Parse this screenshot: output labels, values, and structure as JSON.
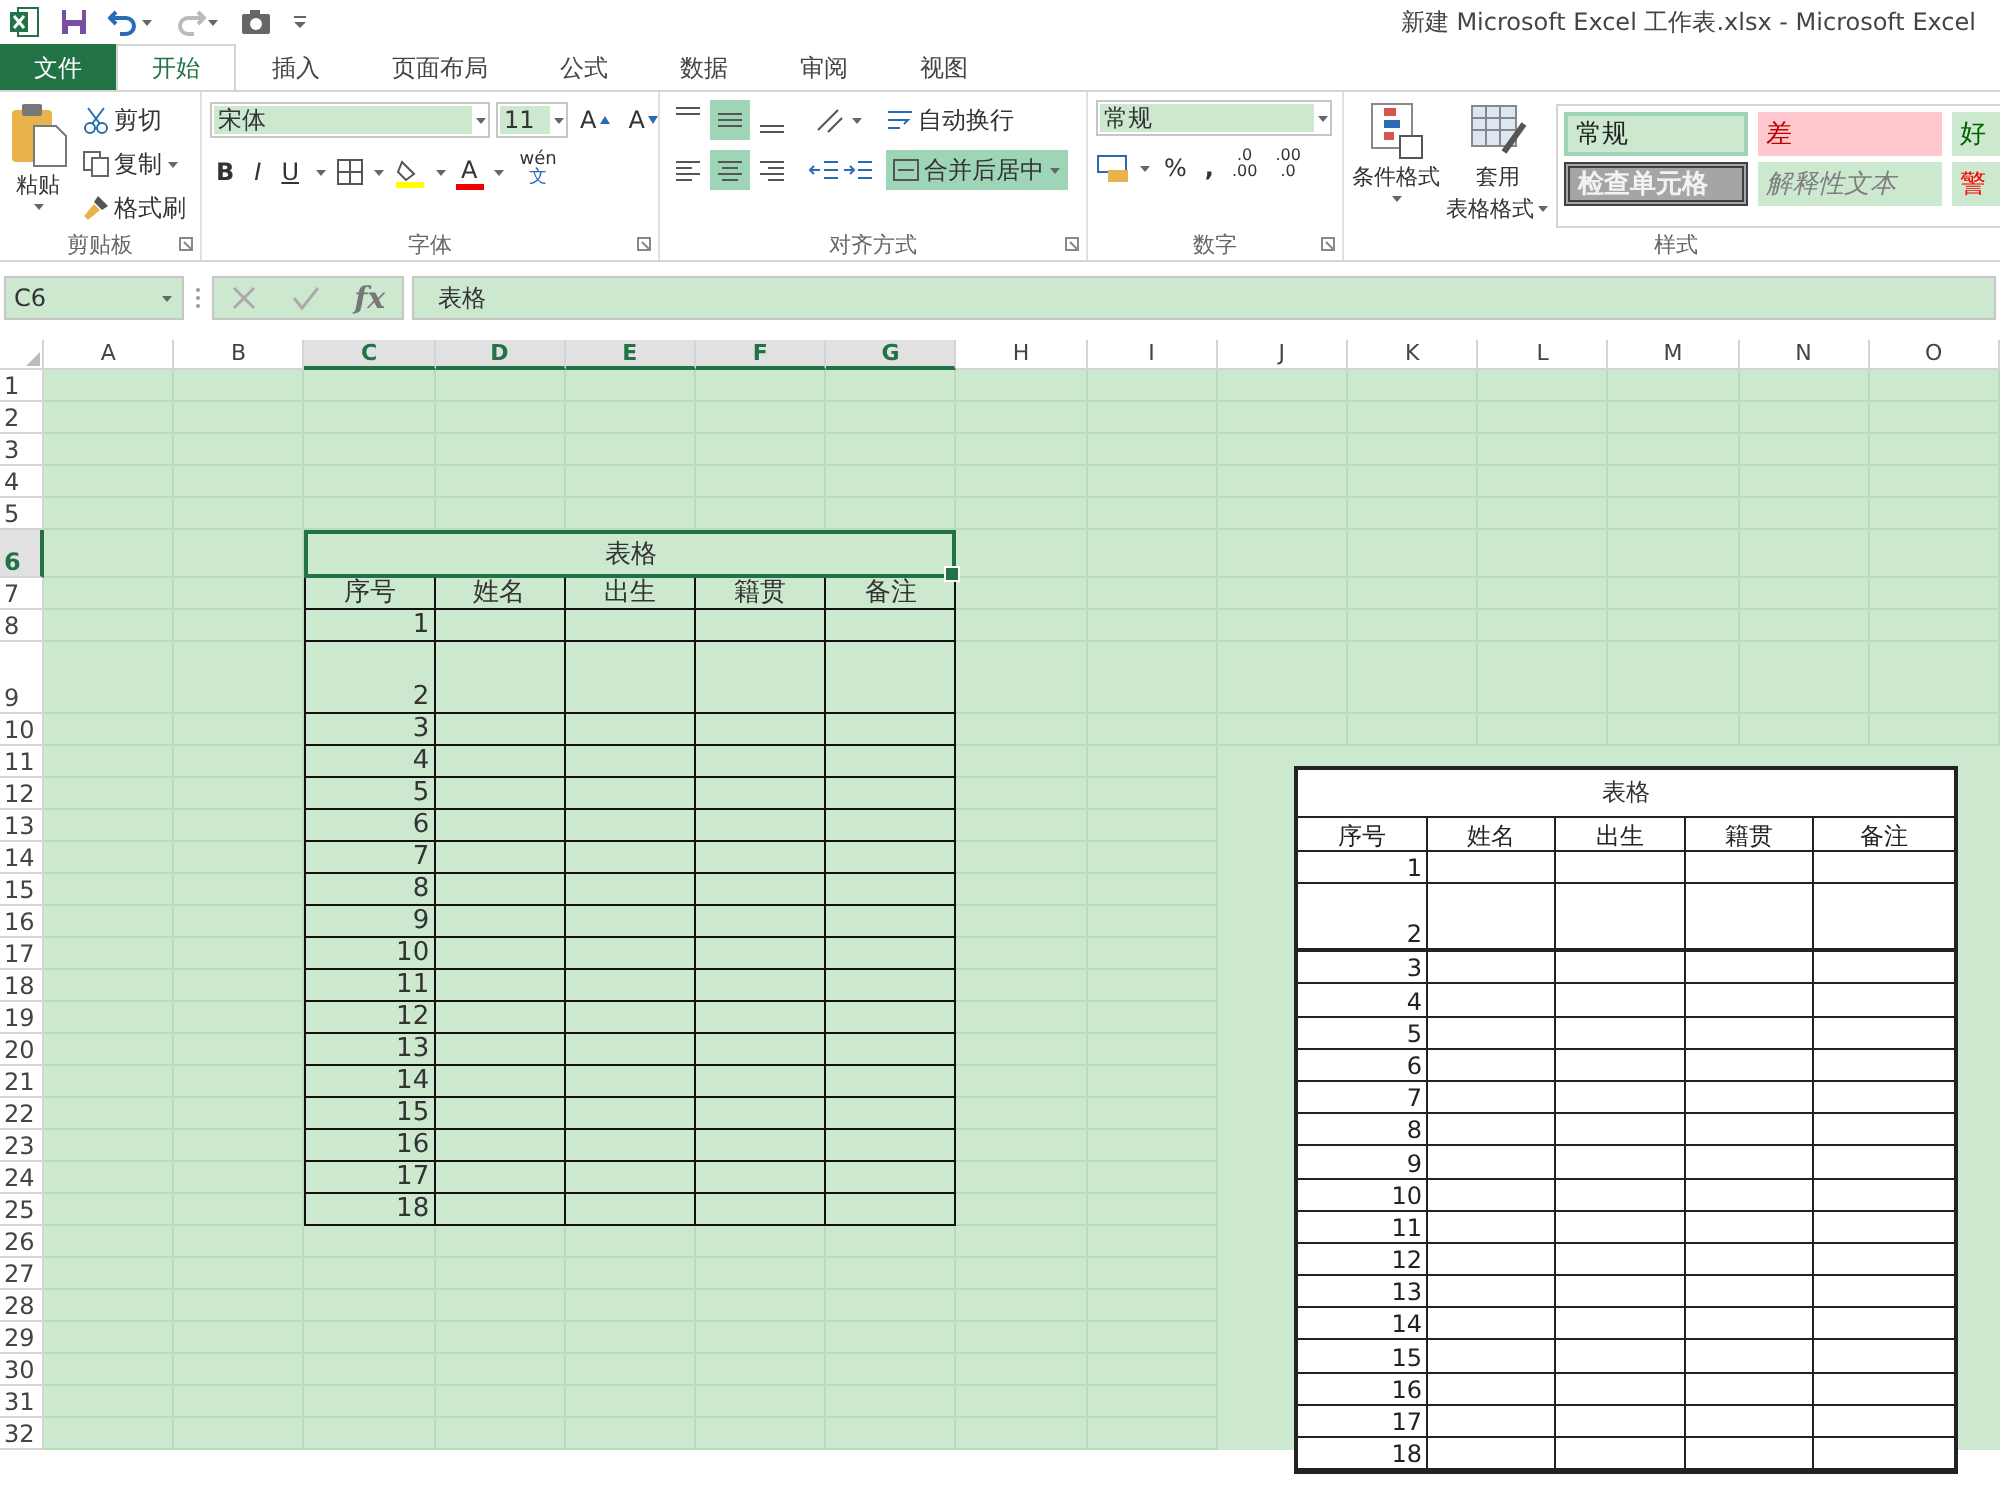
{
  "window": {
    "title": "新建 Microsoft Excel 工作表.xlsx - Microsoft Excel"
  },
  "tabs": [
    {
      "label": "文件",
      "kind": "file",
      "selected": false
    },
    {
      "label": "开始",
      "kind": "tab",
      "selected": true
    },
    {
      "label": "插入",
      "kind": "tab",
      "selected": false
    },
    {
      "label": "页面布局",
      "kind": "tab",
      "selected": false
    },
    {
      "label": "公式",
      "kind": "tab",
      "selected": false
    },
    {
      "label": "数据",
      "kind": "tab",
      "selected": false
    },
    {
      "label": "审阅",
      "kind": "tab",
      "selected": false
    },
    {
      "label": "视图",
      "kind": "tab",
      "selected": false
    }
  ],
  "clipboard": {
    "paste": "粘贴",
    "cut": "剪切",
    "copy": "复制",
    "format_painter": "格式刷",
    "label": "剪贴板"
  },
  "font": {
    "name": "宋体",
    "size": "11",
    "grow": "A",
    "shrink": "A",
    "bold": "B",
    "italic": "I",
    "underline": "U",
    "font_color": "A",
    "phonetic_top": "wén",
    "phonetic_bottom": "文",
    "label": "字体"
  },
  "alignment": {
    "vertical": [
      {
        "kind": "top",
        "selected": false
      },
      {
        "kind": "middle",
        "selected": true
      },
      {
        "kind": "bottom",
        "selected": false
      }
    ],
    "horizontal": [
      {
        "kind": "left",
        "selected": false
      },
      {
        "kind": "center",
        "selected": true
      },
      {
        "kind": "right",
        "selected": false
      }
    ],
    "wrap_text": "自动换行",
    "merge": {
      "label": "合并后居中",
      "selected": true
    },
    "label": "对齐方式"
  },
  "number": {
    "format": "常规",
    "percent": "%",
    "comma": ",",
    "increase_decimal": {
      "top": ".0",
      "bottom": ".00"
    },
    "decrease_decimal": {
      "top": ".00",
      "bottom": ".0"
    },
    "label": "数字"
  },
  "styles": {
    "conditional": "条件格式",
    "table_format_top": "套用",
    "table_format_bottom": "表格格式",
    "label": "样式",
    "cells": [
      {
        "label": "常规",
        "kind": "normal"
      },
      {
        "label": "差",
        "kind": "bad"
      },
      {
        "label": "好",
        "kind": "good"
      },
      {
        "label": "检查单元格",
        "kind": "check"
      },
      {
        "label": "解释性文本",
        "kind": "explanatory"
      },
      {
        "label": "警",
        "kind": "warning"
      }
    ]
  },
  "formula_bar": {
    "name_box": "C6",
    "fx": "fx",
    "formula": "表格"
  },
  "columns": [
    {
      "label": "A",
      "selected": false
    },
    {
      "label": "B",
      "selected": false
    },
    {
      "label": "C",
      "selected": true
    },
    {
      "label": "D",
      "selected": true
    },
    {
      "label": "E",
      "selected": true
    },
    {
      "label": "F",
      "selected": true
    },
    {
      "label": "G",
      "selected": true
    },
    {
      "label": "H",
      "selected": false
    },
    {
      "label": "I",
      "selected": false
    },
    {
      "label": "J",
      "selected": false
    },
    {
      "label": "K",
      "selected": false
    },
    {
      "label": "L",
      "selected": false
    },
    {
      "label": "M",
      "selected": false
    },
    {
      "label": "N",
      "selected": false
    },
    {
      "label": "O",
      "selected": false
    }
  ],
  "rows": [
    {
      "label": "1",
      "selected": false
    },
    {
      "label": "2",
      "selected": false
    },
    {
      "label": "3",
      "selected": false
    },
    {
      "label": "4",
      "selected": false
    },
    {
      "label": "5",
      "selected": false
    },
    {
      "label": "6",
      "selected": true
    },
    {
      "label": "7",
      "selected": false
    },
    {
      "label": "8",
      "selected": false
    },
    {
      "label": "9",
      "selected": false
    },
    {
      "label": "10",
      "selected": false
    },
    {
      "label": "11",
      "selected": false
    },
    {
      "label": "12",
      "selected": false
    },
    {
      "label": "13",
      "selected": false
    },
    {
      "label": "14",
      "selected": false
    },
    {
      "label": "15",
      "selected": false
    },
    {
      "label": "16",
      "selected": false
    },
    {
      "label": "17",
      "selected": false
    },
    {
      "label": "18",
      "selected": false
    },
    {
      "label": "19",
      "selected": false
    },
    {
      "label": "20",
      "selected": false
    },
    {
      "label": "21",
      "selected": false
    },
    {
      "label": "22",
      "selected": false
    },
    {
      "label": "23",
      "selected": false
    },
    {
      "label": "24",
      "selected": false
    },
    {
      "label": "25",
      "selected": false
    },
    {
      "label": "26",
      "selected": false
    },
    {
      "label": "27",
      "selected": false
    },
    {
      "label": "28",
      "selected": false
    },
    {
      "label": "29",
      "selected": false
    },
    {
      "label": "30",
      "selected": false
    },
    {
      "label": "31",
      "selected": false
    },
    {
      "label": "32",
      "selected": false
    }
  ],
  "sheet_table": {
    "title": "表格",
    "headers": [
      "序号",
      "姓名",
      "出生",
      "籍贯",
      "备注"
    ],
    "numbers": [
      "1",
      "2",
      "3",
      "4",
      "5",
      "6",
      "7",
      "8",
      "9",
      "10",
      "11",
      "12",
      "13",
      "14",
      "15",
      "16",
      "17",
      "18"
    ]
  },
  "picture_table": {
    "title": "表格",
    "headers": [
      "序号",
      "姓名",
      "出生",
      "籍贯",
      "备注"
    ],
    "numbers": [
      "1",
      "2",
      "3",
      "4",
      "5",
      "6",
      "7",
      "8",
      "9",
      "10",
      "11",
      "12",
      "13",
      "14",
      "15",
      "16",
      "17",
      "18"
    ]
  }
}
